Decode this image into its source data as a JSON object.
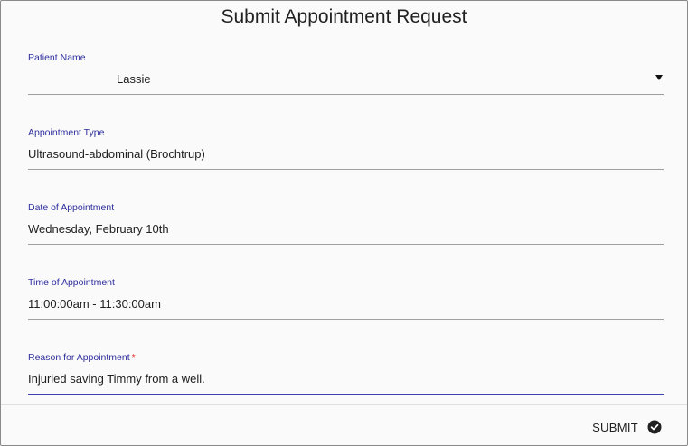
{
  "dialog": {
    "title": "Submit Appointment Request"
  },
  "fields": {
    "patient_name": {
      "label": "Patient Name",
      "value": "Lassie"
    },
    "appointment_type": {
      "label": "Appointment Type",
      "value": "Ultrasound-abdominal (Brochtrup)"
    },
    "date": {
      "label": "Date of Appointment",
      "value": "Wednesday, February 10th"
    },
    "time": {
      "label": "Time of Appointment",
      "value": "11:00:00am - 11:30:00am"
    },
    "reason": {
      "label": "Reason for Appointment",
      "required_mark": "*",
      "value": "Injuried saving Timmy from a well."
    }
  },
  "actions": {
    "submit_label": "SUBMIT",
    "submit_icon": "check-circle-icon"
  },
  "colors": {
    "accent": "#3f3fb1",
    "required": "#e53935"
  }
}
